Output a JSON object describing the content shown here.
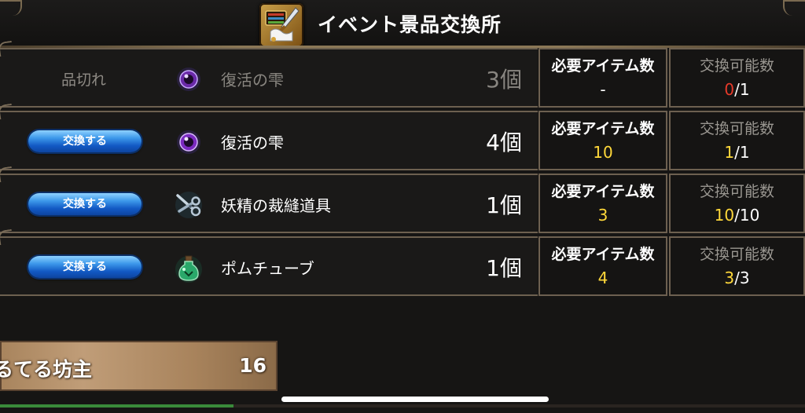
{
  "header": {
    "title": "イベント景品交換所",
    "icon": "event-shop-icon"
  },
  "columns": {
    "required_label": "必要アイテム数",
    "available_label": "交換可能数"
  },
  "rows": [
    {
      "action": "品切れ",
      "sold_out": true,
      "icon": "purple-orb-icon",
      "name": "復活の雫",
      "count": "3個",
      "required": "-",
      "available_current": "0",
      "available_sep": "/",
      "available_max": "1"
    },
    {
      "action": "交換する",
      "sold_out": false,
      "icon": "purple-orb-icon",
      "name": "復活の雫",
      "count": "4個",
      "required": "10",
      "available_current": "1",
      "available_sep": "/",
      "available_max": "1"
    },
    {
      "action": "交換する",
      "sold_out": false,
      "icon": "scissors-icon",
      "name": "妖精の裁縫道具",
      "count": "1個",
      "required": "3",
      "available_current": "10",
      "available_sep": "/",
      "available_max": "10"
    },
    {
      "action": "交換する",
      "sold_out": false,
      "icon": "potion-bottle-icon",
      "name": "ポムチューブ",
      "count": "1個",
      "required": "4",
      "available_current": "3",
      "available_sep": "/",
      "available_max": "3"
    }
  ],
  "bottom": {
    "label": "るてる坊主",
    "value": "16",
    "progress": 0.29
  },
  "colors": {
    "button_blue": "#1259c4",
    "highlight_yellow": "#ffd83a",
    "zero_red": "#e63a2a",
    "panel_tan": "#c09d78"
  }
}
